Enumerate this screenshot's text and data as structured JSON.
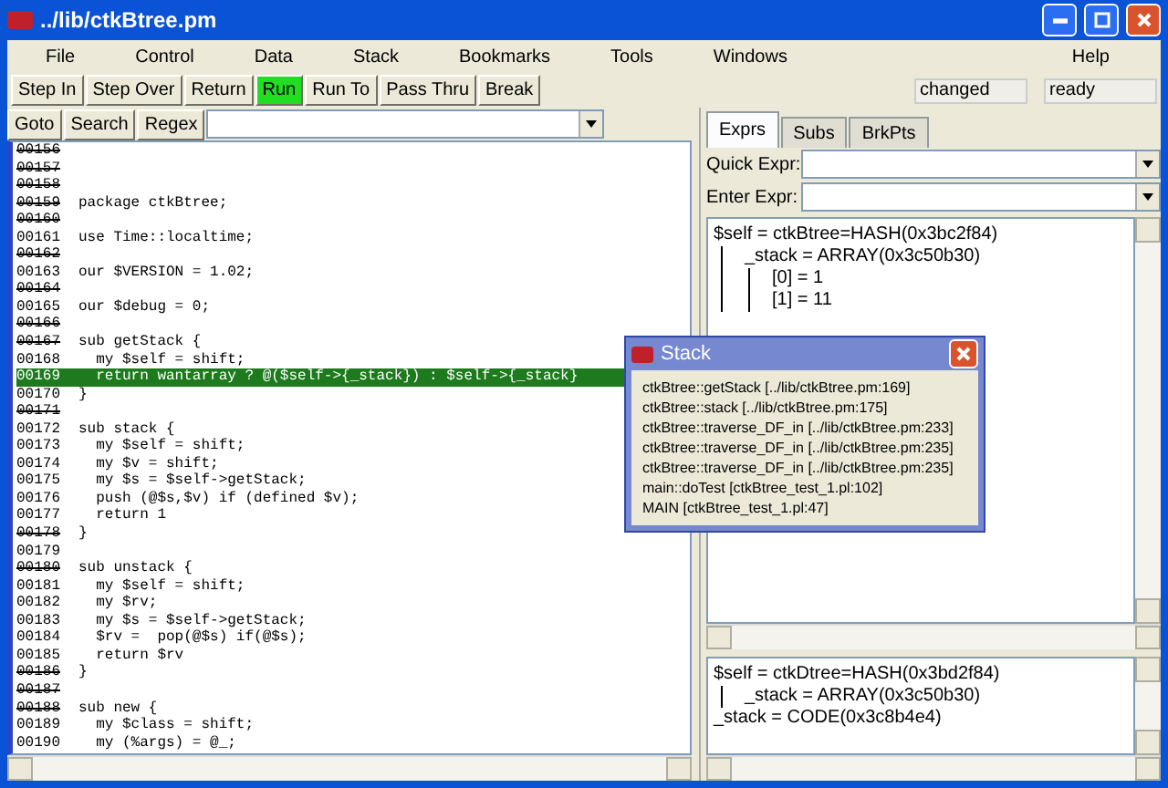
{
  "window": {
    "title": "../lib/ctkBtree.pm"
  },
  "menu": [
    "File",
    "Control",
    "Data",
    "Stack",
    "Bookmarks",
    "Tools",
    "Windows",
    "Help"
  ],
  "toolbar": [
    {
      "label": "Step In",
      "highlighted": false
    },
    {
      "label": "Step Over",
      "highlighted": false
    },
    {
      "label": "Return",
      "highlighted": false
    },
    {
      "label": "Run",
      "highlighted": true
    },
    {
      "label": "Run To",
      "highlighted": false
    },
    {
      "label": "Pass Thru",
      "highlighted": false
    },
    {
      "label": "Break",
      "highlighted": false
    }
  ],
  "status": [
    "changed",
    "ready"
  ],
  "search_bar": {
    "buttons": [
      "Goto",
      "Search",
      "Regex"
    ]
  },
  "source": [
    {
      "line": "00156",
      "breakable": false,
      "current": false
    },
    {
      "line": "00157",
      "breakable": false,
      "current": false
    },
    {
      "line": "00158",
      "breakable": false,
      "current": false
    },
    {
      "line": "00159",
      "code": "package ctkBtree;",
      "breakable": false,
      "current": false
    },
    {
      "line": "00160",
      "breakable": false,
      "current": false
    },
    {
      "line": "00161",
      "code": "use Time::localtime;",
      "breakable": true,
      "current": false
    },
    {
      "line": "00162",
      "breakable": false,
      "current": false
    },
    {
      "line": "00163",
      "code": "our $VERSION = 1.02;",
      "breakable": true,
      "current": false
    },
    {
      "line": "00164",
      "breakable": false,
      "current": false
    },
    {
      "line": "00165",
      "code": "our $debug = 0;",
      "breakable": true,
      "current": false
    },
    {
      "line": "00166",
      "breakable": false,
      "current": false
    },
    {
      "line": "00167",
      "code": "sub getStack {",
      "breakable": false,
      "current": false
    },
    {
      "line": "00168",
      "code": "  my $self = shift;",
      "breakable": true,
      "current": false
    },
    {
      "line": "00169",
      "code": "  return wantarray ? @($self->{_stack}) : $self->{_stack}",
      "breakable": true,
      "current": true
    },
    {
      "line": "00170",
      "code": "}",
      "breakable": true,
      "current": false
    },
    {
      "line": "00171",
      "breakable": false,
      "current": false
    },
    {
      "line": "00172",
      "code": "sub stack {",
      "breakable": true,
      "current": false
    },
    {
      "line": "00173",
      "code": "  my $self = shift;",
      "breakable": true,
      "current": false
    },
    {
      "line": "00174",
      "code": "  my $v = shift;",
      "breakable": true,
      "current": false
    },
    {
      "line": "00175",
      "code": "  my $s = $self->getStack;",
      "breakable": true,
      "current": false
    },
    {
      "line": "00176",
      "code": "  push (@$s,$v) if (defined $v);",
      "breakable": true,
      "current": false
    },
    {
      "line": "00177",
      "code": "  return 1",
      "breakable": true,
      "current": false
    },
    {
      "line": "00178",
      "code": "}",
      "breakable": false,
      "current": false
    },
    {
      "line": "00179",
      "breakable": true,
      "current": false
    },
    {
      "line": "00180",
      "code": "sub unstack {",
      "breakable": false,
      "current": false
    },
    {
      "line": "00181",
      "code": "  my $self = shift;",
      "breakable": true,
      "current": false
    },
    {
      "line": "00182",
      "code": "  my $rv;",
      "breakable": true,
      "current": false
    },
    {
      "line": "00183",
      "code": "  my $s = $self->getStack;",
      "breakable": true,
      "current": false
    },
    {
      "line": "00184",
      "code": "  $rv =  pop(@$s) if(@$s);",
      "breakable": true,
      "current": false
    },
    {
      "line": "00185",
      "code": "  return $rv",
      "breakable": true,
      "current": false
    },
    {
      "line": "00186",
      "code": "}",
      "breakable": false,
      "current": false
    },
    {
      "line": "00187",
      "breakable": false,
      "current": false
    },
    {
      "line": "00188",
      "code": "sub new {",
      "breakable": false,
      "current": false
    },
    {
      "line": "00189",
      "code": "  my $class = shift;",
      "breakable": true,
      "current": false
    },
    {
      "line": "00190",
      "code": "  my (%args) = @_;",
      "breakable": true,
      "current": false
    }
  ],
  "tabs": [
    {
      "label": "Exprs",
      "selected": true
    },
    {
      "label": "Subs",
      "selected": false
    },
    {
      "label": "BrkPts",
      "selected": false
    }
  ],
  "fields": [
    {
      "label": "Quick Expr:"
    },
    {
      "label": "Enter Expr:"
    }
  ],
  "expr_tree": [
    {
      "text": "$self = ctkBtree=HASH(0x3bc2f84)",
      "children": [
        {
          "text": "_stack = ARRAY(0x3c50b30)",
          "children": [
            {
              "text": "[0] = 1"
            },
            {
              "text": "[1] = 11"
            }
          ]
        }
      ]
    }
  ],
  "bottom_tree": [
    {
      "text": "$self = ctkDtree=HASH(0x3bd2f84)",
      "children": [
        {
          "text": "_stack = ARRAY(0x3c50b30)"
        }
      ]
    },
    {
      "text": "_stack = CODE(0x3c8b4e4)"
    }
  ],
  "stack_popup": {
    "title": "Stack",
    "frames": [
      "ctkBtree::getStack [../lib/ctkBtree.pm:169]",
      "ctkBtree::stack [../lib/ctkBtree.pm:175]",
      "ctkBtree::traverse_DF_in [../lib/ctkBtree.pm:233]",
      "ctkBtree::traverse_DF_in [../lib/ctkBtree.pm:235]",
      "ctkBtree::traverse_DF_in [../lib/ctkBtree.pm:235]",
      "main::doTest [ctkBtree_test_1.pl:102]",
      "MAIN [ctkBtree_test_1.pl:47]"
    ]
  }
}
